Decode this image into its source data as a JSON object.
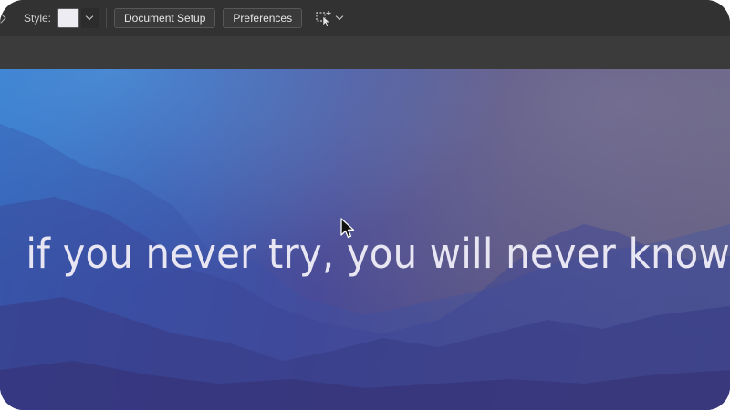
{
  "toolbar": {
    "style_label": "Style:",
    "style_swatch_color": "#ececf2",
    "document_setup_label": "Document Setup",
    "preferences_label": "Preferences",
    "arrange_icon": "arrange-documents-icon"
  },
  "canvas": {
    "quote_text": "if you never try, you will never know."
  },
  "colors": {
    "toolbar_bg": "#323232",
    "canvas_left": "#2f6fc4",
    "canvas_right": "#645f80",
    "quote_text": "#e8e6f2"
  }
}
